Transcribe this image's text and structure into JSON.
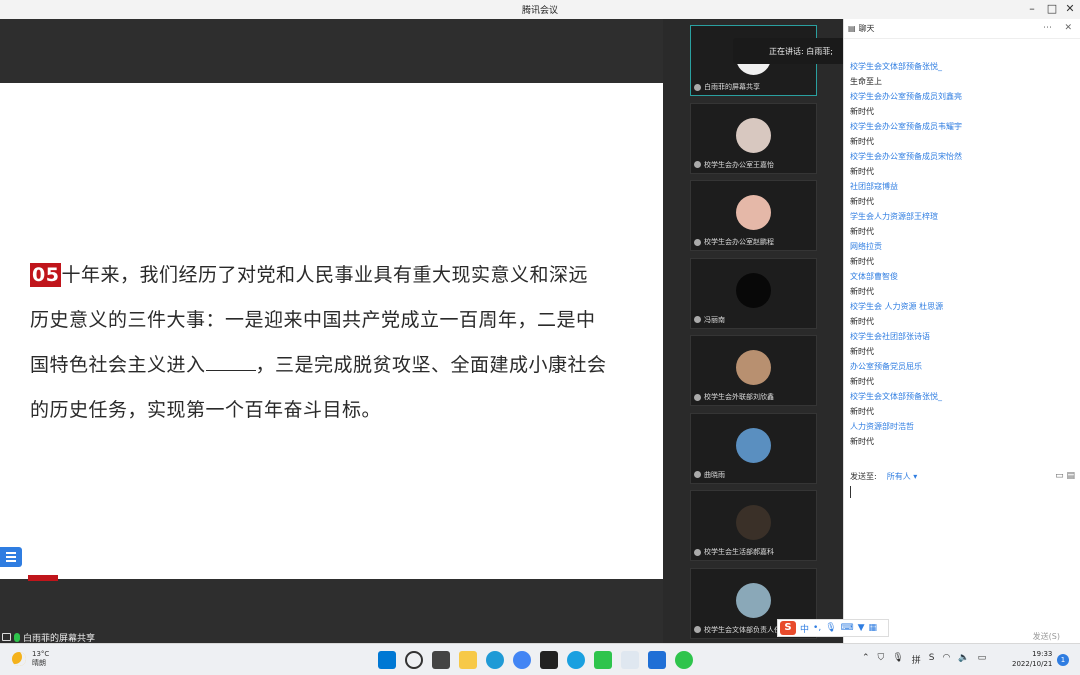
{
  "window": {
    "title": "腾讯会议"
  },
  "slide": {
    "number": "05",
    "line1": "十年来，我们经历了对党和人民事业具有重大现实意义和深远",
    "line2": "历史意义的三件大事：一是迎来中国共产党成立一百周年，二是中",
    "line3a": "国特色社会主义进入",
    "line3b": "，三是完成脱贫攻坚、全面建成小康社会",
    "line4": "的历史任务，实现第一个百年奋斗目标。"
  },
  "share_label": "白雨菲的屏幕共享",
  "speaking": "正在讲话: 白雨菲;",
  "gallery": [
    {
      "name": "白雨菲的屏幕共享",
      "color": "#f0f0f0",
      "active": true
    },
    {
      "name": "校学生会办公室王嘉怡",
      "color": "#d8c8c0",
      "active": false
    },
    {
      "name": "校学生会办公室赵鹏程",
      "color": "#e5b8a8",
      "active": false
    },
    {
      "name": "冯丽南",
      "color": "#080808",
      "active": false
    },
    {
      "name": "校学生会外联部刘欣鑫",
      "color": "#b89070",
      "active": false
    },
    {
      "name": "曲晓雨",
      "color": "#5a8fc0",
      "active": false
    },
    {
      "name": "校学生会生活部郝嘉科",
      "color": "#3a3028",
      "active": false
    },
    {
      "name": "校学生会文体部负责人任",
      "color": "#8aa8b8",
      "active": false
    }
  ],
  "chat": {
    "title": "聊天",
    "messages": [
      {
        "name": "校学生会文体部预备张悦_",
        "text": "生命至上"
      },
      {
        "name": "校学生会办公室预备成员刘鑫亮",
        "text": "新时代"
      },
      {
        "name": "校学生会办公室预备成员韦耀宇",
        "text": "新时代"
      },
      {
        "name": "校学生会办公室预备成员宋怡然",
        "text": "新时代"
      },
      {
        "name": "社团部寇博益",
        "text": "新时代"
      },
      {
        "name": "学生会人力资源部王梓瑄",
        "text": "新时代"
      },
      {
        "name": "网络拉贡",
        "text": "新时代"
      },
      {
        "name": "文体部曹智俊",
        "text": "新时代"
      },
      {
        "name": "校学生会 人力资源 杜思源",
        "text": "新时代"
      },
      {
        "name": "校学生会社团部张诗语",
        "text": "新时代"
      },
      {
        "name": "办公室预备党员屈乐",
        "text": "新时代"
      },
      {
        "name": "校学生会文体部预备张悦_",
        "text": "新时代"
      },
      {
        "name": "人力资源部时浩哲",
        "text": "新时代"
      }
    ],
    "send_to_label": "发送至:",
    "send_to_value": "所有人",
    "send_button": "发送(S)"
  },
  "ime": {
    "mode": "中"
  },
  "taskbar": {
    "weather_temp": "13°C",
    "weather_desc": "晴朗",
    "time": "19:33",
    "date": "2022/10/21",
    "notifications": "1"
  },
  "colors": {
    "accent": "#2f7de1",
    "slide_red": "#c0151b"
  }
}
